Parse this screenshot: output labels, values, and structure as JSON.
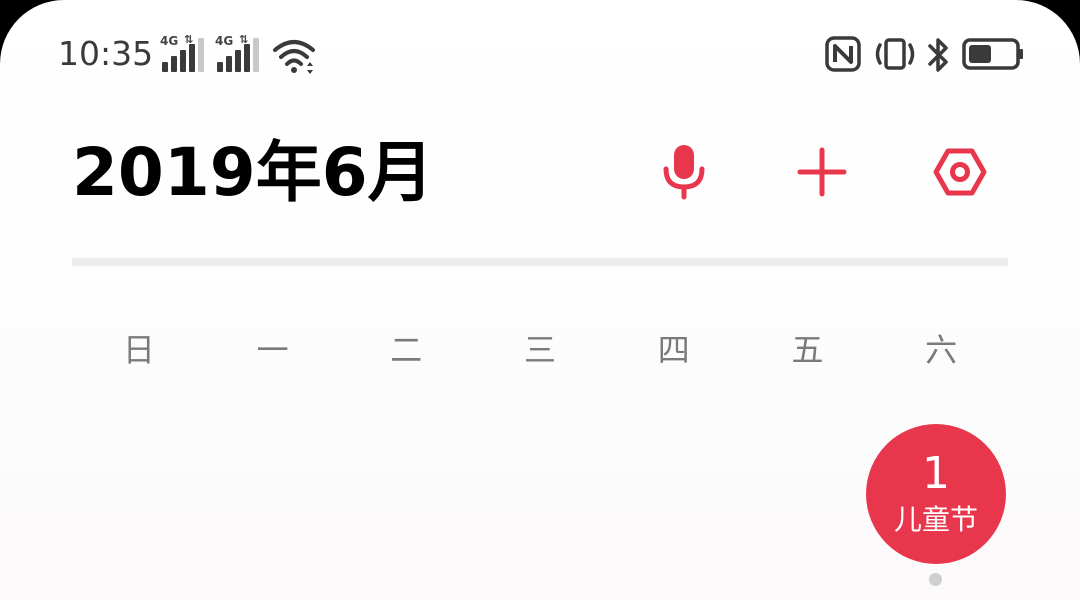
{
  "status_bar": {
    "time": "10:35",
    "signal_1_label": "4G",
    "signal_2_label": "4G",
    "icons": [
      "4g-signal-icon",
      "4g-signal-icon",
      "wifi-icon",
      "nfc-icon",
      "vibrate-icon",
      "bluetooth-icon",
      "battery-icon"
    ]
  },
  "header": {
    "title": "2019年6月",
    "buttons": [
      "microphone-icon",
      "add-icon",
      "settings-icon"
    ],
    "accent_color": "#e8374d"
  },
  "calendar": {
    "weekdays": [
      "日",
      "一",
      "二",
      "三",
      "四",
      "五",
      "六"
    ],
    "selected_day": {
      "number": "1",
      "label": "儿童节"
    }
  }
}
